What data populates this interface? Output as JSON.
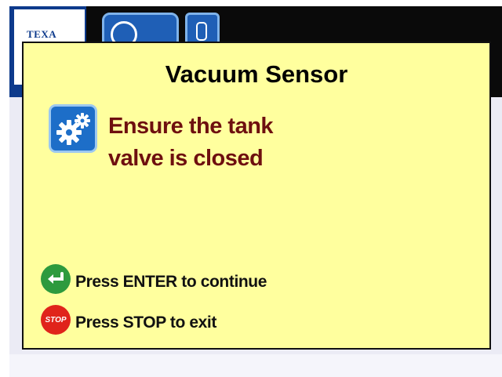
{
  "header": {
    "brand": "TEXA"
  },
  "dialog": {
    "title": "Vacuum Sensor",
    "message_line1": "Ensure the tank",
    "message_line2": "valve is closed",
    "hint_enter": "Press ENTER to continue",
    "hint_stop": "Press STOP to exit",
    "stop_badge": "STOP"
  },
  "colors": {
    "dialog_bg": "#ffff9e",
    "message": "#6e0f0f",
    "enter_button": "#2d9a3e",
    "stop_button": "#e0241b",
    "icon_bg": "#1d6ec8"
  },
  "icons": {
    "message_icon": "gears-icon",
    "enter_icon": "enter-return-icon",
    "stop_icon": "stop-icon"
  }
}
